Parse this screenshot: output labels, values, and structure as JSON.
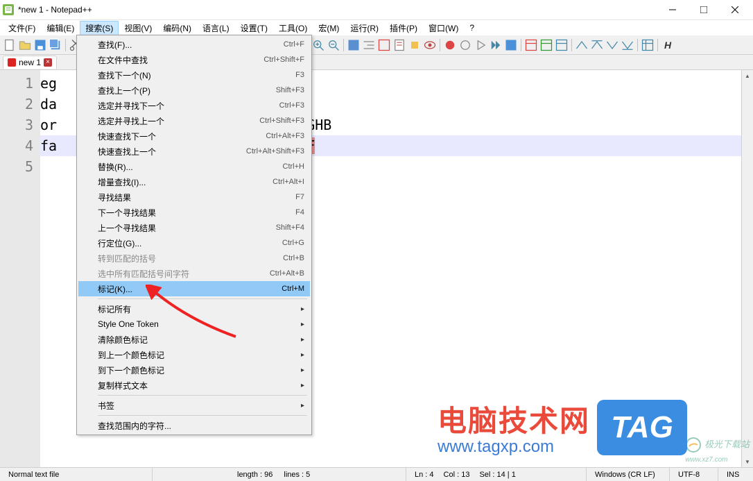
{
  "window": {
    "title": "*new 1 - Notepad++"
  },
  "menu": {
    "items": [
      "文件(F)",
      "编辑(E)",
      "搜索(S)",
      "视图(V)",
      "编码(N)",
      "语言(L)",
      "设置(T)",
      "工具(O)",
      "宏(M)",
      "运行(R)",
      "插件(P)",
      "窗口(W)",
      "?"
    ],
    "active_index": 2
  },
  "tab": {
    "name": "new 1"
  },
  "editor": {
    "lines": [
      {
        "n": "1",
        "text": "eg"
      },
      {
        "n": "2",
        "text": "da"
      },
      {
        "n": "3",
        "text": "or",
        "tail": "DGBGHB"
      },
      {
        "n": "4",
        "text": "fa",
        "tail": "FHGF",
        "hl": true,
        "hl_tail": true
      },
      {
        "n": "5",
        "text": ""
      }
    ]
  },
  "dropdown": [
    {
      "label": "查找(F)...",
      "shortcut": "Ctrl+F"
    },
    {
      "label": "在文件中查找",
      "shortcut": "Ctrl+Shift+F"
    },
    {
      "label": "查找下一个(N)",
      "shortcut": "F3"
    },
    {
      "label": "查找上一个(P)",
      "shortcut": "Shift+F3"
    },
    {
      "label": "选定并寻找下一个",
      "shortcut": "Ctrl+F3"
    },
    {
      "label": "选定并寻找上一个",
      "shortcut": "Ctrl+Shift+F3"
    },
    {
      "label": "快速查找下一个",
      "shortcut": "Ctrl+Alt+F3"
    },
    {
      "label": "快速查找上一个",
      "shortcut": "Ctrl+Alt+Shift+F3"
    },
    {
      "label": "替换(R)...",
      "shortcut": "Ctrl+H"
    },
    {
      "label": "增量查找(I)...",
      "shortcut": "Ctrl+Alt+I"
    },
    {
      "label": "寻找结果",
      "shortcut": "F7"
    },
    {
      "label": "下一个寻找结果",
      "shortcut": "F4"
    },
    {
      "label": "上一个寻找结果",
      "shortcut": "Shift+F4"
    },
    {
      "label": "行定位(G)...",
      "shortcut": "Ctrl+G"
    },
    {
      "label": "转到匹配的括号",
      "shortcut": "Ctrl+B",
      "disabled": true
    },
    {
      "label": "选中所有匹配括号间字符",
      "shortcut": "Ctrl+Alt+B",
      "disabled": true
    },
    {
      "label": "标记(K)...",
      "shortcut": "Ctrl+M",
      "highlight": true
    },
    {
      "sep": true
    },
    {
      "label": "标记所有",
      "submenu": true
    },
    {
      "label": "Style One Token",
      "submenu": true
    },
    {
      "label": "清除颜色标记",
      "submenu": true
    },
    {
      "label": "到上一个颜色标记",
      "submenu": true
    },
    {
      "label": "到下一个颜色标记",
      "submenu": true
    },
    {
      "label": "复制样式文本",
      "submenu": true
    },
    {
      "sep": true
    },
    {
      "label": "书签",
      "submenu": true
    },
    {
      "sep": true
    },
    {
      "label": "查找范围内的字符..."
    }
  ],
  "statusbar": {
    "file_type": "Normal text file",
    "length": "length : 96",
    "lines": "lines : 5",
    "ln": "Ln : 4",
    "col": "Col : 13",
    "sel": "Sel : 14 | 1",
    "eol": "Windows (CR LF)",
    "encoding": "UTF-8",
    "mode": "INS"
  },
  "watermark": {
    "cn": "电脑技术网",
    "url": "www.tagxp.com",
    "tag": "TAG",
    "xz": "极光下载站",
    "xz_url": "www.xz7.com"
  }
}
